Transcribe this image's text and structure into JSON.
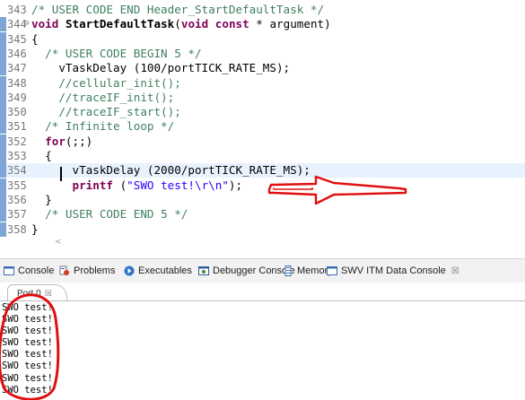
{
  "editor": {
    "lines": [
      {
        "no": "343",
        "fold": "",
        "changed": false,
        "tokens": [
          {
            "t": "/* USER CODE END Header_StartDefaultTask */",
            "c": "cm"
          }
        ]
      },
      {
        "no": "344",
        "fold": "⊖",
        "changed": true,
        "tokens": [
          {
            "t": "void",
            "c": "kw"
          },
          {
            "t": " ",
            "c": ""
          },
          {
            "t": "StartDefaultTask",
            "c": "fn"
          },
          {
            "t": "(",
            "c": ""
          },
          {
            "t": "void",
            "c": "kw"
          },
          {
            "t": " ",
            "c": ""
          },
          {
            "t": "const",
            "c": "kw"
          },
          {
            "t": " * argument)",
            "c": ""
          }
        ]
      },
      {
        "no": "345",
        "fold": "",
        "changed": true,
        "tokens": [
          {
            "t": "{",
            "c": ""
          }
        ]
      },
      {
        "no": "346",
        "fold": "",
        "changed": true,
        "tokens": [
          {
            "t": "  /* USER CODE BEGIN 5 */",
            "c": "cm"
          }
        ]
      },
      {
        "no": "347",
        "fold": "",
        "changed": true,
        "tokens": [
          {
            "t": "    vTaskDelay (100/portTICK_RATE_MS);",
            "c": ""
          }
        ]
      },
      {
        "no": "348",
        "fold": "",
        "changed": true,
        "tokens": [
          {
            "t": "    //cellular_init();",
            "c": "cm"
          }
        ]
      },
      {
        "no": "349",
        "fold": "",
        "changed": true,
        "tokens": [
          {
            "t": "    //traceIF_init();",
            "c": "cm"
          }
        ]
      },
      {
        "no": "350",
        "fold": "",
        "changed": true,
        "tokens": [
          {
            "t": "    //traceIF_start();",
            "c": "cm"
          }
        ]
      },
      {
        "no": "351",
        "fold": "",
        "changed": true,
        "tokens": [
          {
            "t": "  /* Infinite loop */",
            "c": "cm"
          }
        ]
      },
      {
        "no": "352",
        "fold": "",
        "changed": true,
        "tokens": [
          {
            "t": "  ",
            "c": ""
          },
          {
            "t": "for",
            "c": "kw"
          },
          {
            "t": "(;;)",
            "c": ""
          }
        ]
      },
      {
        "no": "353",
        "fold": "",
        "changed": true,
        "tokens": [
          {
            "t": "  {",
            "c": ""
          }
        ]
      },
      {
        "no": "354",
        "fold": "",
        "changed": true,
        "current": true,
        "tokens": [
          {
            "t": "      vTaskDelay (2000/portTICK_RATE_MS);",
            "c": ""
          }
        ]
      },
      {
        "no": "355",
        "fold": "",
        "changed": true,
        "tokens": [
          {
            "t": "      ",
            "c": ""
          },
          {
            "t": "printf",
            "c": "kw"
          },
          {
            "t": " (",
            "c": ""
          },
          {
            "t": "\"SWO test!\\r\\n\"",
            "c": "str"
          },
          {
            "t": ");",
            "c": ""
          }
        ]
      },
      {
        "no": "356",
        "fold": "",
        "changed": true,
        "tokens": [
          {
            "t": "  }",
            "c": ""
          }
        ]
      },
      {
        "no": "357",
        "fold": "",
        "changed": true,
        "tokens": [
          {
            "t": "  /* USER CODE END 5 */",
            "c": "cm"
          }
        ]
      },
      {
        "no": "358",
        "fold": "",
        "changed": true,
        "tokens": [
          {
            "t": "}",
            "c": ""
          }
        ]
      }
    ],
    "scroll_left_glyph": "<"
  },
  "view_tabs": [
    {
      "label": "Console",
      "icon": "console-icon"
    },
    {
      "label": "Problems",
      "icon": "problems-icon"
    },
    {
      "label": "Executables",
      "icon": "executables-icon"
    },
    {
      "label": "Debugger Console",
      "icon": "debugger-console-icon"
    },
    {
      "label": "Memory",
      "icon": "memory-icon"
    },
    {
      "label": "SWV ITM Data Console",
      "icon": "swv-console-icon",
      "active": true,
      "close": "☒"
    }
  ],
  "console": {
    "port_tab": {
      "label": "Port 0",
      "close": "☒"
    },
    "output": [
      "SWO test!",
      "SWO test!",
      "SWO test!",
      "SWO test!",
      "SWO test!",
      "SWO test!",
      "SWO test!",
      "SWO test!"
    ]
  },
  "annotation_colors": {
    "arrow": "#e01010",
    "ellipse": "#e01010"
  }
}
